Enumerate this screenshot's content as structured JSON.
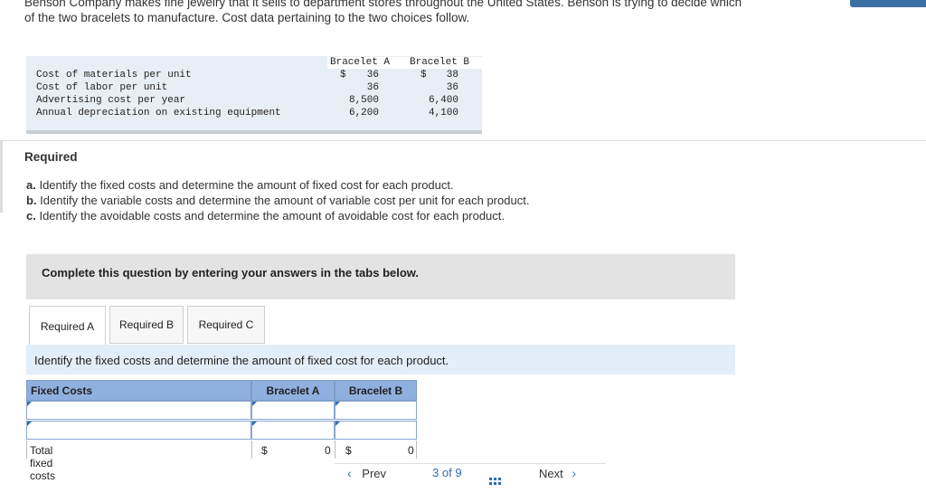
{
  "intro": {
    "line1": "Benson Company makes fine jewelry that it sells to department stores throughout the United States. Benson is trying to decide which",
    "line2": "of the two bracelets to manufacture. Cost data pertaining to the two choices follow."
  },
  "cost_table": {
    "headers": [
      "Bracelet A",
      "Bracelet B"
    ],
    "rows": [
      {
        "label": "Cost of materials per unit",
        "a": "36",
        "b": "38",
        "a_prefix": "$",
        "b_prefix": "$"
      },
      {
        "label": "Cost of labor per unit",
        "a": "36",
        "b": "36"
      },
      {
        "label": "Advertising cost per year",
        "a": "8,500",
        "b": "6,400"
      },
      {
        "label": "Annual depreciation on existing equipment",
        "a": "6,200",
        "b": "4,100"
      }
    ]
  },
  "required": {
    "title": "Required",
    "items": [
      {
        "letter": "a.",
        "text": " Identify the fixed costs and determine the amount of fixed cost for each product."
      },
      {
        "letter": "b.",
        "text": " Identify the variable costs and determine the amount of variable cost per unit for each product."
      },
      {
        "letter": "c.",
        "text": " Identify the avoidable costs and determine the amount of avoidable cost for each product."
      }
    ]
  },
  "instruction": "Complete this question by entering your answers in the tabs below.",
  "tabs": [
    {
      "label": "Required A",
      "active": true
    },
    {
      "label": "Required B",
      "active": false
    },
    {
      "label": "Required C",
      "active": false
    }
  ],
  "tab_prompt": "Identify the fixed costs and determine the amount of fixed cost for each product.",
  "answer_table": {
    "col_label": "Fixed Costs",
    "col_a": "Bracelet A",
    "col_b": "Bracelet B",
    "total_label": "Total fixed costs",
    "total_a_prefix": "$",
    "total_a": "0",
    "total_b_prefix": "$",
    "total_b": "0"
  },
  "footer": {
    "prev": "Prev",
    "page": "3",
    "of": "of",
    "total": "9",
    "next": "Next"
  },
  "colors": {
    "header_blue": "#8fb0df",
    "prompt_band": "#e2eef9",
    "instruction_band": "#e3e3e3",
    "accent": "#2d6db5"
  }
}
